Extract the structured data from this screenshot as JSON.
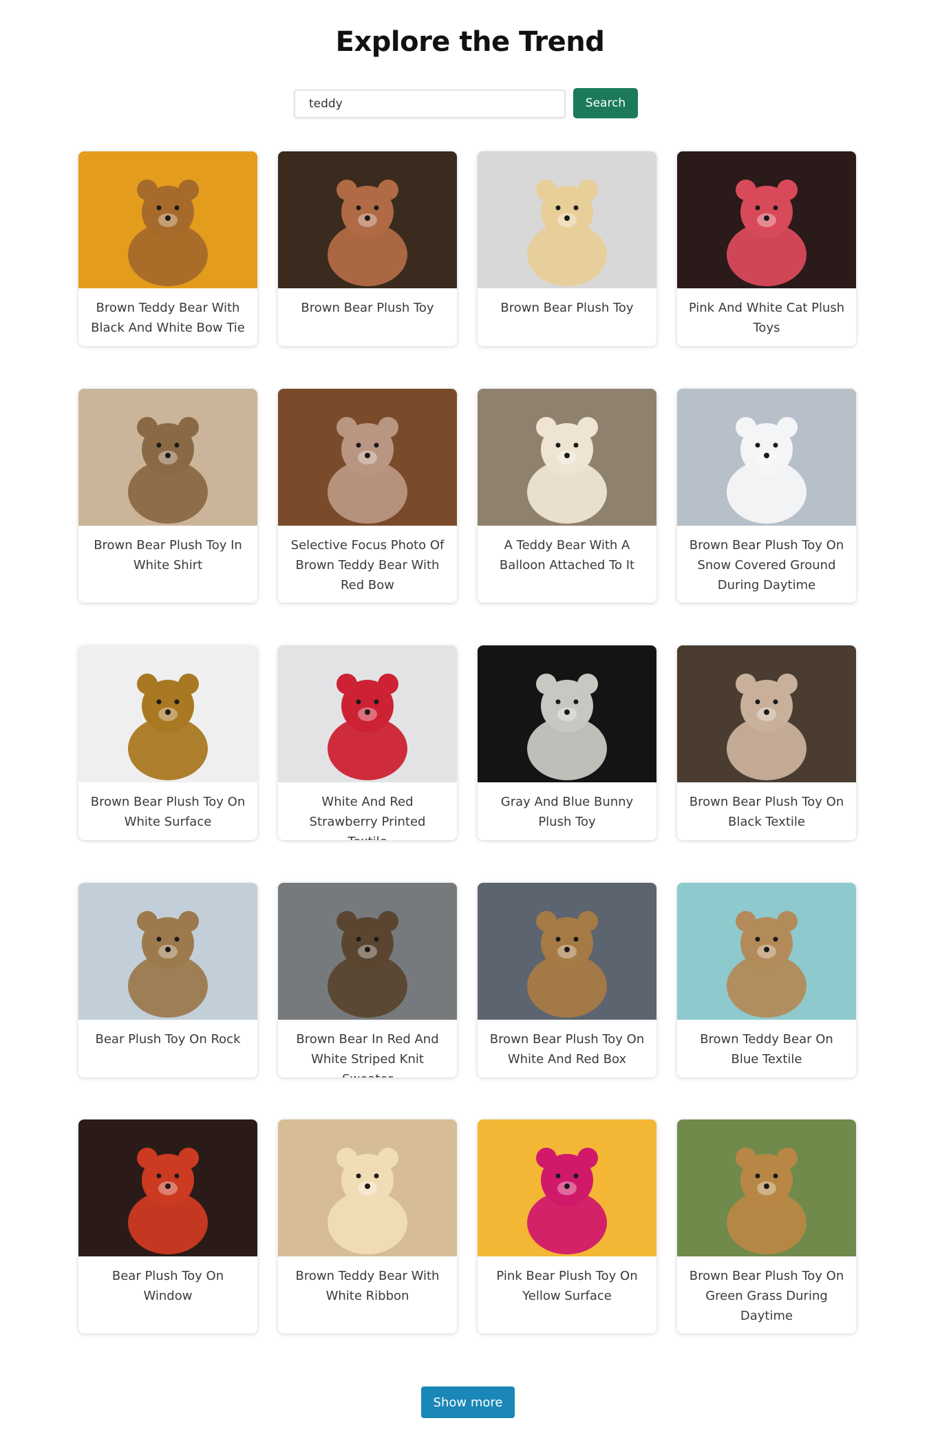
{
  "header": {
    "title": "Explore the Trend"
  },
  "search": {
    "value": "teddy",
    "button_label": "Search"
  },
  "results": [
    {
      "caption": "Brown Teddy Bear With Black And White Bow Tie",
      "bg": "#e39c1c",
      "fg": "#a66a2a"
    },
    {
      "caption": "Brown Bear Plush Toy",
      "bg": "#3a2b1e",
      "fg": "#b06a45"
    },
    {
      "caption": "Brown Bear Plush Toy",
      "bg": "#d8d8d8",
      "fg": "#e8cf9a"
    },
    {
      "caption": "Pink And White Cat Plush Toys",
      "bg": "#2a1a1a",
      "fg": "#d84a5a"
    },
    {
      "caption": "Brown Bear Plush Toy In White Shirt",
      "bg": "#cbb59a",
      "fg": "#8a6a44"
    },
    {
      "caption": "Selective Focus Photo Of Brown Teddy Bear With Red Bow",
      "bg": "#7a4b2a",
      "fg": "#b99682"
    },
    {
      "caption": "A Teddy Bear With A Balloon Attached To It",
      "bg": "#8e826e",
      "fg": "#efe4d2"
    },
    {
      "caption": "Brown Bear Plush Toy On Snow Covered Ground During Daytime",
      "bg": "#b7c0c9",
      "fg": "#f4f5f7"
    },
    {
      "caption": "Brown Bear Plush Toy On White Surface",
      "bg": "#efefef",
      "fg": "#a97822"
    },
    {
      "caption": "White And Red Strawberry Printed Textile",
      "bg": "#e3e3e6",
      "fg": "#cc2233"
    },
    {
      "caption": "Gray And Blue Bunny Plush Toy",
      "bg": "#141414",
      "fg": "#c9c7c1"
    },
    {
      "caption": "Brown Bear Plush Toy On Black Textile",
      "bg": "#4a3c31",
      "fg": "#c8b09a"
    },
    {
      "caption": "Bear Plush Toy On Rock",
      "bg": "#c2cfd8",
      "fg": "#9c7a4e"
    },
    {
      "caption": "Brown Bear In Red And White Striped Knit Sweater",
      "bg": "#777a7c",
      "fg": "#5a4630"
    },
    {
      "caption": "Brown Bear Plush Toy On White And Red Box",
      "bg": "#5c6470",
      "fg": "#a67a44"
    },
    {
      "caption": "Brown Teddy Bear On Blue Textile",
      "bg": "#8ec9cd",
      "fg": "#b38b5a"
    },
    {
      "caption": "Bear Plush Toy On Window",
      "bg": "#2b1b18",
      "fg": "#cc3a22"
    },
    {
      "caption": "Brown Teddy Bear With White Ribbon",
      "bg": "#d6bd96",
      "fg": "#f1ddb5"
    },
    {
      "caption": "Pink Bear Plush Toy On Yellow Surface",
      "bg": "#f3b735",
      "fg": "#d1196a"
    },
    {
      "caption": "Brown Bear Plush Toy On Green Grass During Daytime",
      "bg": "#6f8a4b",
      "fg": "#b88745"
    }
  ],
  "footer": {
    "show_more_label": "Show more"
  }
}
